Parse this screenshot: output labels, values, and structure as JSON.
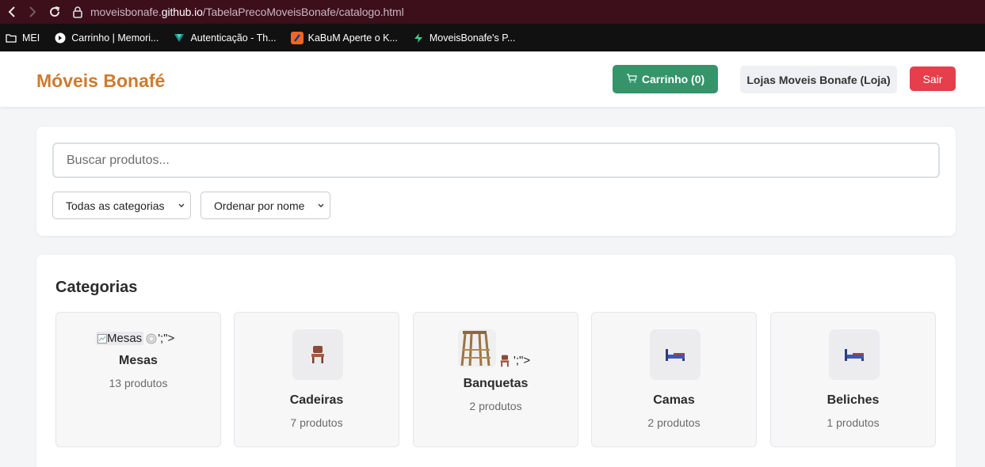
{
  "browser": {
    "url_host": "moveisbonafe.github.io",
    "url_path": "/TabelaPrecoMoveisBonafe/catalogo.html",
    "url_prefix": "moveisbonafe."
  },
  "bookmarks": [
    {
      "label": "MEI",
      "icon": "folder-icon"
    },
    {
      "label": "Carrinho | Memori...",
      "icon": "site-icon"
    },
    {
      "label": "Autenticação - Th...",
      "icon": "vuetify-icon"
    },
    {
      "label": "KaBuM Aperte o K...",
      "icon": "kabum-icon"
    },
    {
      "label": "MoveisBonafe's P...",
      "icon": "supabase-icon"
    }
  ],
  "header": {
    "brand": "Móveis Bonafé",
    "cart_label": "Carrinho (0)",
    "store_label": "Lojas Moveis Bonafe (Loja)",
    "exit_label": "Sair"
  },
  "search": {
    "placeholder": "Buscar produtos...",
    "category_select": "Todas as categorias",
    "order_select": "Ordenar por nome"
  },
  "categories": {
    "title": "Categorias",
    "items": [
      {
        "name": "Mesas",
        "count": "13 produtos",
        "broken_alt": "Mesas",
        "broken_tail": "';\">"
      },
      {
        "name": "Cadeiras",
        "count": "7 produtos"
      },
      {
        "name": "Banquetas",
        "count": "2 produtos",
        "broken_tail": "';\">"
      },
      {
        "name": "Camas",
        "count": "2 produtos"
      },
      {
        "name": "Beliches",
        "count": "1 produtos"
      }
    ]
  },
  "colors": {
    "brand": "#cd7b2f",
    "cart_button": "#35946a",
    "exit_button": "#e63e4b"
  }
}
